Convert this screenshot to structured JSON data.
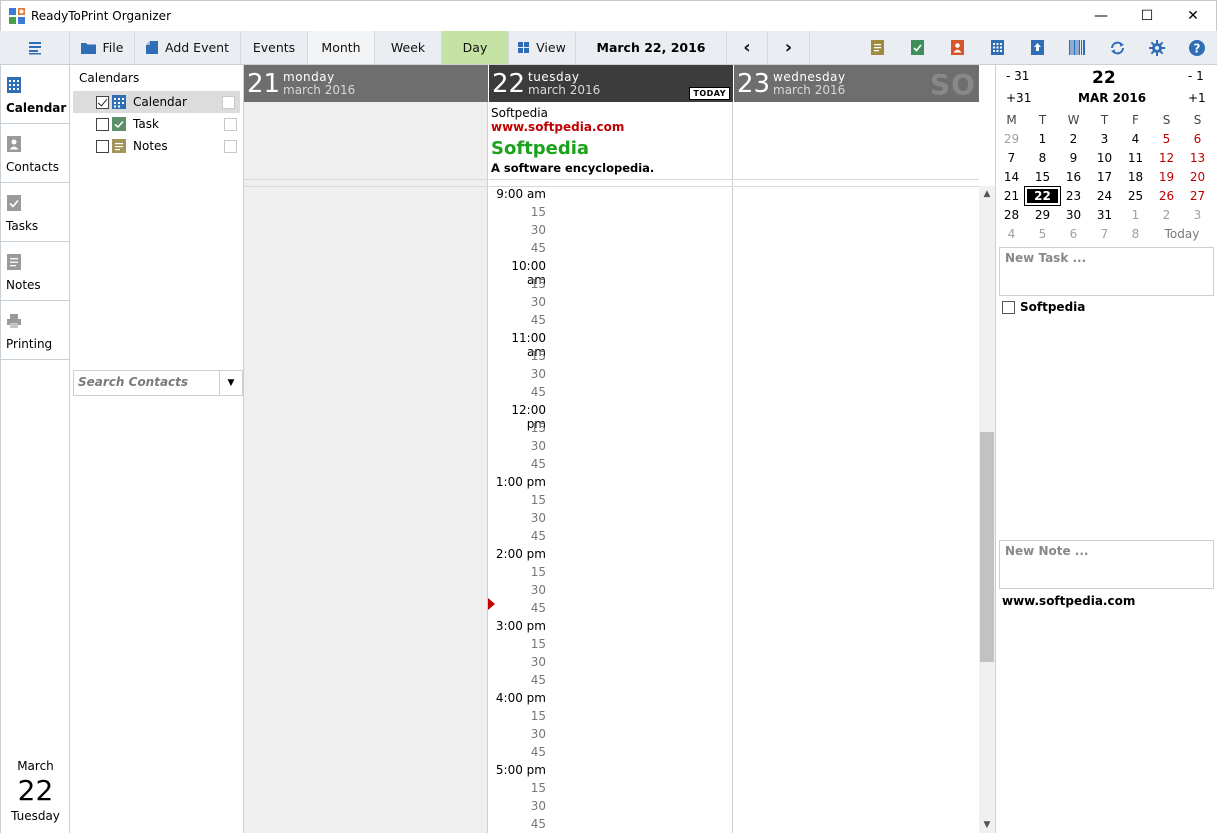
{
  "window": {
    "title": "ReadyToPrint Organizer",
    "minimize": "—",
    "maximize": "☐",
    "close": "✕"
  },
  "toolbar": {
    "file": "File",
    "add_event": "Add Event",
    "events": "Events",
    "month": "Month",
    "week": "Week",
    "day": "Day",
    "view": "View",
    "current_date": "March 22, 2016",
    "prev": "‹",
    "next": "›"
  },
  "nav": {
    "items": [
      "Calendar",
      "Contacts",
      "Tasks",
      "Notes",
      "Printing"
    ],
    "date_month": "March",
    "date_day": "22",
    "date_weekday": "Tuesday"
  },
  "calendars": {
    "header": "Calendars",
    "items": [
      "Calendar",
      "Task",
      "Notes"
    ],
    "search_placeholder": "Search Contacts"
  },
  "days": [
    {
      "num": "21",
      "weekday": "monday",
      "month": "march 2016"
    },
    {
      "num": "22",
      "weekday": "tuesday",
      "month": "march 2016",
      "badge": "TODAY"
    },
    {
      "num": "23",
      "weekday": "wednesday",
      "month": "march 2016"
    }
  ],
  "event": {
    "line1": "Softpedia",
    "line2": "www.softpedia.com",
    "line3": "Softpedia",
    "line4": "A software encyclopedia."
  },
  "time_slots": [
    "9:00 am",
    "15",
    "30",
    "45",
    "10:00 am",
    "15",
    "30",
    "45",
    "11:00 am",
    "15",
    "30",
    "45",
    "12:00 pm",
    "15",
    "30",
    "45",
    "1:00 pm",
    "15",
    "30",
    "45",
    "2:00 pm",
    "15",
    "30",
    "45",
    "3:00 pm",
    "15",
    "30",
    "45",
    "4:00 pm",
    "15",
    "30",
    "45",
    "5:00 pm",
    "15",
    "30",
    "45"
  ],
  "mini_cal": {
    "minus31": "- 31",
    "plus31": "+31",
    "minus1": "- 1",
    "plus1": "+1",
    "day": "22",
    "month_year": "MAR 2016",
    "weekdays": [
      "M",
      "T",
      "W",
      "T",
      "F",
      "S",
      "S"
    ],
    "weeks": [
      [
        "29",
        "1",
        "2",
        "3",
        "4",
        "5",
        "6"
      ],
      [
        "7",
        "8",
        "9",
        "10",
        "11",
        "12",
        "13"
      ],
      [
        "14",
        "15",
        "16",
        "17",
        "18",
        "19",
        "20"
      ],
      [
        "21",
        "22",
        "23",
        "24",
        "25",
        "26",
        "27"
      ],
      [
        "28",
        "29",
        "30",
        "31",
        "1",
        "2",
        "3"
      ],
      [
        "4",
        "5",
        "6",
        "7",
        "8"
      ]
    ],
    "today_label": "Today"
  },
  "right": {
    "new_task": "New Task ...",
    "task_item": "Softpedia",
    "new_note": "New Note ...",
    "note_item": "www.softpedia.com"
  },
  "watermark": "SOFTPEDIA",
  "colors": {
    "toolbar_bg": "#eaeef3",
    "active_view": "#c6e3a6",
    "day_head_other": "#6e6e6e",
    "day_head_today": "#3c3c3c",
    "link_red": "#c00000",
    "title_green": "#1aa31a",
    "weekend_red": "#c00000"
  }
}
